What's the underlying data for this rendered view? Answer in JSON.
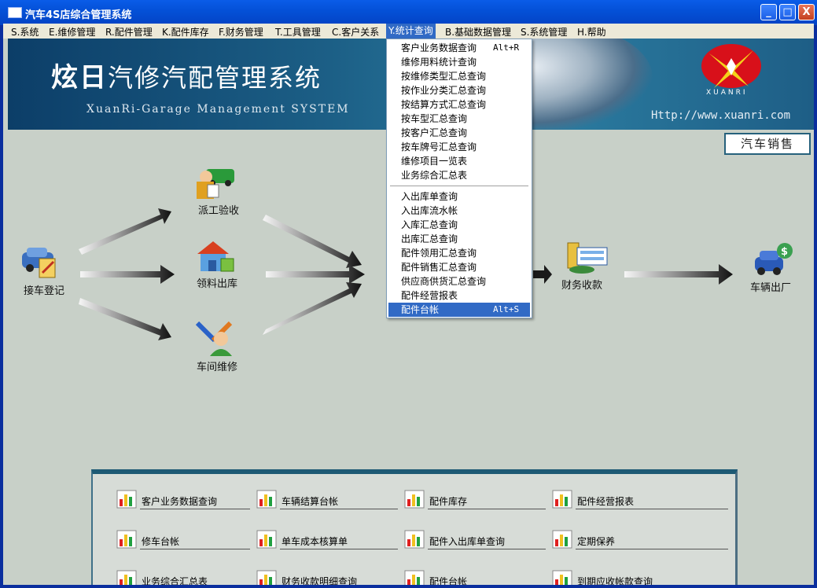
{
  "window": {
    "title": "汽车4S店综合管理系统"
  },
  "titlebar_buttons": {
    "minimize": "_",
    "maximize": "□",
    "close": "X"
  },
  "menubar": [
    {
      "label": "S.系统"
    },
    {
      "label": "E.维修管理"
    },
    {
      "label": "R.配件管理"
    },
    {
      "label": "K.配件库存"
    },
    {
      "label": "F.财务管理"
    },
    {
      "label": "T.工具管理"
    },
    {
      "label": "C.客户关系"
    },
    {
      "label": "Y.统计查询"
    },
    {
      "label": "B.基础数据管理"
    },
    {
      "label": "S.系统管理"
    },
    {
      "label": "H.帮助"
    }
  ],
  "banner": {
    "title_big": "炫日",
    "title_rest": "汽修汽配管理系统",
    "subtitle": "XuanRi-Garage Management SYSTEM",
    "url": "Http://www.xuanri.com",
    "logo_text": "XUANRI"
  },
  "sales_button": "汽车销售",
  "flow": {
    "reception": "接车登记",
    "dispatch": "派工验收",
    "parts_issue": "领料出库",
    "workshop": "车间维修",
    "finance": "财务收款",
    "exit": "车辆出厂"
  },
  "stats_menu": {
    "group1": [
      {
        "label": "客户业务数据查询",
        "shortcut": "Alt+R"
      },
      {
        "label": "维修用料统计查询",
        "shortcut": ""
      },
      {
        "label": "按维修类型汇总查询",
        "shortcut": ""
      },
      {
        "label": "按作业分类汇总查询",
        "shortcut": ""
      },
      {
        "label": "按结算方式汇总查询",
        "shortcut": ""
      },
      {
        "label": "按车型汇总查询",
        "shortcut": ""
      },
      {
        "label": "按客户汇总查询",
        "shortcut": ""
      },
      {
        "label": "按车牌号汇总查询",
        "shortcut": ""
      },
      {
        "label": "维修项目一览表",
        "shortcut": ""
      },
      {
        "label": "业务综合汇总表",
        "shortcut": ""
      }
    ],
    "group2": [
      {
        "label": "入出库单查询",
        "shortcut": ""
      },
      {
        "label": "入出库流水帐",
        "shortcut": ""
      },
      {
        "label": "入库汇总查询",
        "shortcut": ""
      },
      {
        "label": "出库汇总查询",
        "shortcut": ""
      },
      {
        "label": "配件领用汇总查询",
        "shortcut": ""
      },
      {
        "label": "配件销售汇总查询",
        "shortcut": ""
      },
      {
        "label": "供应商供货汇总查询",
        "shortcut": ""
      },
      {
        "label": "配件经营报表",
        "shortcut": ""
      },
      {
        "label": "配件台帐",
        "shortcut": "Alt+S"
      }
    ]
  },
  "quick_panel": [
    "客户业务数据查询",
    "车辆结算台帐",
    "配件库存",
    "配件经营报表",
    "修车台帐",
    "单车成本核算单",
    "配件入出库单查询",
    "定期保养",
    "业务综合汇总表",
    "财务收款明细查询",
    "配件台帐",
    "到期应收帐款查询"
  ]
}
